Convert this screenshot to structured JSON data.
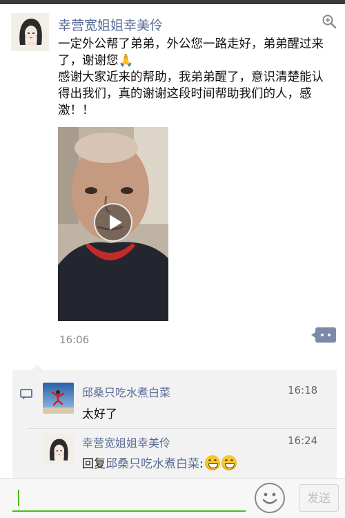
{
  "post": {
    "author": "幸营宽姐姐幸美伶",
    "avatar": "portrait-illustration-avatar",
    "paragraph1": "一定外公帮了弟弟，外公您一路走好，弟弟醒过来了，谢谢您🙏",
    "paragraph2": "感谢大家近来的帮助，我弟弟醒了，意识清楚能认得出我们，真的谢谢这段时间帮助我们的人，感激！！",
    "video": {
      "thumbnail": "man-portrait-video-thumbnail",
      "icon": "play-icon"
    },
    "time": "16:06",
    "icons": {
      "zoom": "zoom-icon",
      "more": "more-actions-icon"
    }
  },
  "comments": [
    {
      "name": "邱桑只吃水煮白菜",
      "time": "16:18",
      "text": "太好了",
      "avatar": "jumping-person-avatar"
    },
    {
      "name": "幸营宽姐姐幸美伶",
      "time": "16:24",
      "reply_prefix": "回复",
      "reply_to": "邱桑只吃水煮白菜",
      "reply_suffix": ":",
      "emoji": [
        "grinning-emoji",
        "grinning-emoji"
      ],
      "avatar": "portrait-illustration-avatar"
    }
  ],
  "comment_icon": "comment-icon",
  "input_bar": {
    "value": "",
    "emoji_icon": "emoji-face-icon",
    "send_label": "发送"
  },
  "colors": {
    "link": "#576b95",
    "accent": "#45c01a",
    "comment_bg": "#f2f2f2"
  }
}
